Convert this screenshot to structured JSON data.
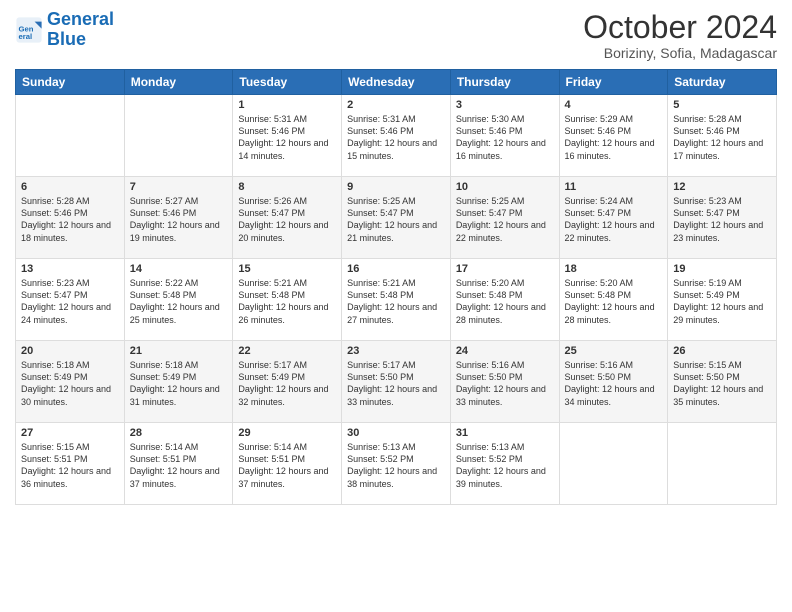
{
  "logo": {
    "line1": "General",
    "line2": "Blue"
  },
  "title": "October 2024",
  "subtitle": "Boriziny, Sofia, Madagascar",
  "days": [
    "Sunday",
    "Monday",
    "Tuesday",
    "Wednesday",
    "Thursday",
    "Friday",
    "Saturday"
  ],
  "weeks": [
    [
      {
        "num": "",
        "sunrise": "",
        "sunset": "",
        "daylight": ""
      },
      {
        "num": "",
        "sunrise": "",
        "sunset": "",
        "daylight": ""
      },
      {
        "num": "1",
        "sunrise": "Sunrise: 5:31 AM",
        "sunset": "Sunset: 5:46 PM",
        "daylight": "Daylight: 12 hours and 14 minutes."
      },
      {
        "num": "2",
        "sunrise": "Sunrise: 5:31 AM",
        "sunset": "Sunset: 5:46 PM",
        "daylight": "Daylight: 12 hours and 15 minutes."
      },
      {
        "num": "3",
        "sunrise": "Sunrise: 5:30 AM",
        "sunset": "Sunset: 5:46 PM",
        "daylight": "Daylight: 12 hours and 16 minutes."
      },
      {
        "num": "4",
        "sunrise": "Sunrise: 5:29 AM",
        "sunset": "Sunset: 5:46 PM",
        "daylight": "Daylight: 12 hours and 16 minutes."
      },
      {
        "num": "5",
        "sunrise": "Sunrise: 5:28 AM",
        "sunset": "Sunset: 5:46 PM",
        "daylight": "Daylight: 12 hours and 17 minutes."
      }
    ],
    [
      {
        "num": "6",
        "sunrise": "Sunrise: 5:28 AM",
        "sunset": "Sunset: 5:46 PM",
        "daylight": "Daylight: 12 hours and 18 minutes."
      },
      {
        "num": "7",
        "sunrise": "Sunrise: 5:27 AM",
        "sunset": "Sunset: 5:46 PM",
        "daylight": "Daylight: 12 hours and 19 minutes."
      },
      {
        "num": "8",
        "sunrise": "Sunrise: 5:26 AM",
        "sunset": "Sunset: 5:47 PM",
        "daylight": "Daylight: 12 hours and 20 minutes."
      },
      {
        "num": "9",
        "sunrise": "Sunrise: 5:25 AM",
        "sunset": "Sunset: 5:47 PM",
        "daylight": "Daylight: 12 hours and 21 minutes."
      },
      {
        "num": "10",
        "sunrise": "Sunrise: 5:25 AM",
        "sunset": "Sunset: 5:47 PM",
        "daylight": "Daylight: 12 hours and 22 minutes."
      },
      {
        "num": "11",
        "sunrise": "Sunrise: 5:24 AM",
        "sunset": "Sunset: 5:47 PM",
        "daylight": "Daylight: 12 hours and 22 minutes."
      },
      {
        "num": "12",
        "sunrise": "Sunrise: 5:23 AM",
        "sunset": "Sunset: 5:47 PM",
        "daylight": "Daylight: 12 hours and 23 minutes."
      }
    ],
    [
      {
        "num": "13",
        "sunrise": "Sunrise: 5:23 AM",
        "sunset": "Sunset: 5:47 PM",
        "daylight": "Daylight: 12 hours and 24 minutes."
      },
      {
        "num": "14",
        "sunrise": "Sunrise: 5:22 AM",
        "sunset": "Sunset: 5:48 PM",
        "daylight": "Daylight: 12 hours and 25 minutes."
      },
      {
        "num": "15",
        "sunrise": "Sunrise: 5:21 AM",
        "sunset": "Sunset: 5:48 PM",
        "daylight": "Daylight: 12 hours and 26 minutes."
      },
      {
        "num": "16",
        "sunrise": "Sunrise: 5:21 AM",
        "sunset": "Sunset: 5:48 PM",
        "daylight": "Daylight: 12 hours and 27 minutes."
      },
      {
        "num": "17",
        "sunrise": "Sunrise: 5:20 AM",
        "sunset": "Sunset: 5:48 PM",
        "daylight": "Daylight: 12 hours and 28 minutes."
      },
      {
        "num": "18",
        "sunrise": "Sunrise: 5:20 AM",
        "sunset": "Sunset: 5:48 PM",
        "daylight": "Daylight: 12 hours and 28 minutes."
      },
      {
        "num": "19",
        "sunrise": "Sunrise: 5:19 AM",
        "sunset": "Sunset: 5:49 PM",
        "daylight": "Daylight: 12 hours and 29 minutes."
      }
    ],
    [
      {
        "num": "20",
        "sunrise": "Sunrise: 5:18 AM",
        "sunset": "Sunset: 5:49 PM",
        "daylight": "Daylight: 12 hours and 30 minutes."
      },
      {
        "num": "21",
        "sunrise": "Sunrise: 5:18 AM",
        "sunset": "Sunset: 5:49 PM",
        "daylight": "Daylight: 12 hours and 31 minutes."
      },
      {
        "num": "22",
        "sunrise": "Sunrise: 5:17 AM",
        "sunset": "Sunset: 5:49 PM",
        "daylight": "Daylight: 12 hours and 32 minutes."
      },
      {
        "num": "23",
        "sunrise": "Sunrise: 5:17 AM",
        "sunset": "Sunset: 5:50 PM",
        "daylight": "Daylight: 12 hours and 33 minutes."
      },
      {
        "num": "24",
        "sunrise": "Sunrise: 5:16 AM",
        "sunset": "Sunset: 5:50 PM",
        "daylight": "Daylight: 12 hours and 33 minutes."
      },
      {
        "num": "25",
        "sunrise": "Sunrise: 5:16 AM",
        "sunset": "Sunset: 5:50 PM",
        "daylight": "Daylight: 12 hours and 34 minutes."
      },
      {
        "num": "26",
        "sunrise": "Sunrise: 5:15 AM",
        "sunset": "Sunset: 5:50 PM",
        "daylight": "Daylight: 12 hours and 35 minutes."
      }
    ],
    [
      {
        "num": "27",
        "sunrise": "Sunrise: 5:15 AM",
        "sunset": "Sunset: 5:51 PM",
        "daylight": "Daylight: 12 hours and 36 minutes."
      },
      {
        "num": "28",
        "sunrise": "Sunrise: 5:14 AM",
        "sunset": "Sunset: 5:51 PM",
        "daylight": "Daylight: 12 hours and 37 minutes."
      },
      {
        "num": "29",
        "sunrise": "Sunrise: 5:14 AM",
        "sunset": "Sunset: 5:51 PM",
        "daylight": "Daylight: 12 hours and 37 minutes."
      },
      {
        "num": "30",
        "sunrise": "Sunrise: 5:13 AM",
        "sunset": "Sunset: 5:52 PM",
        "daylight": "Daylight: 12 hours and 38 minutes."
      },
      {
        "num": "31",
        "sunrise": "Sunrise: 5:13 AM",
        "sunset": "Sunset: 5:52 PM",
        "daylight": "Daylight: 12 hours and 39 minutes."
      },
      {
        "num": "",
        "sunrise": "",
        "sunset": "",
        "daylight": ""
      },
      {
        "num": "",
        "sunrise": "",
        "sunset": "",
        "daylight": ""
      }
    ]
  ]
}
